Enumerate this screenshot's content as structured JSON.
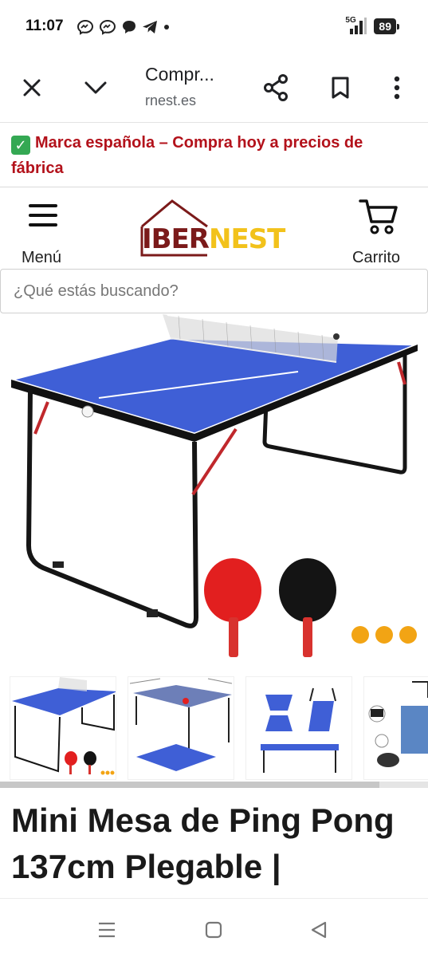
{
  "status_bar": {
    "time": "11:07",
    "network": "5G",
    "battery": "89",
    "icons": [
      "messenger-icon",
      "messenger-icon",
      "chat-bubble-icon",
      "telegram-icon",
      "dot-icon"
    ]
  },
  "browser": {
    "title": "Compr...",
    "url": "rnest.es",
    "icons": [
      "close-icon",
      "chevron-down-icon",
      "share-icon",
      "bookmark-icon",
      "more-vert-icon"
    ]
  },
  "promo": {
    "text": "Marca española – Compra hoy a precios de fábrica",
    "color": "#b3121b"
  },
  "header": {
    "menu_label": "Menú",
    "logo_part1": "IBER",
    "logo_part2": "NEST",
    "cart_label": "Carrito",
    "brand_colors": {
      "dark_red": "#7b1a1a",
      "yellow": "#f2c21b"
    }
  },
  "search": {
    "placeholder": "¿Qué estás buscando?"
  },
  "product": {
    "title": "Mini Mesa de Ping Pong 137cm Plegable |",
    "table_color": "#3f5fd6",
    "thumbnails": [
      "thumbnail-table-with-paddles",
      "thumbnail-table-dimensions",
      "thumbnail-folding-steps",
      "thumbnail-accessories"
    ]
  },
  "nav_bar": {
    "icons": [
      "recents-icon",
      "home-icon",
      "back-icon"
    ]
  }
}
